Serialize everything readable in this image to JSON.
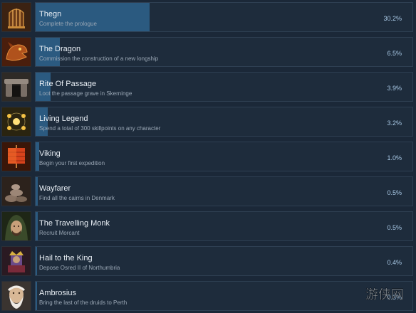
{
  "achievements": [
    {
      "title": "Thegn",
      "description": "Complete the prologue",
      "percent": "30.2%",
      "progress": 0.302,
      "icon": "cage-icon"
    },
    {
      "title": "The Dragon",
      "description": "Commission the construction of a new longship",
      "percent": "6.5%",
      "progress": 0.065,
      "icon": "dragon-head-icon"
    },
    {
      "title": "Rite Of Passage",
      "description": "Loot the passage grave in Skerninge",
      "percent": "3.9%",
      "progress": 0.039,
      "icon": "standing-stones-icon"
    },
    {
      "title": "Living Legend",
      "description": "Spend a total of 300 skillpoints on any character",
      "percent": "3.2%",
      "progress": 0.032,
      "icon": "glowing-orbs-icon"
    },
    {
      "title": "Viking",
      "description": "Begin your first expedition",
      "percent": "1.0%",
      "progress": 0.01,
      "icon": "sail-icon"
    },
    {
      "title": "Wayfarer",
      "description": "Find all the cairns in Denmark",
      "percent": "0.5%",
      "progress": 0.005,
      "icon": "cairn-icon"
    },
    {
      "title": "The Travelling Monk",
      "description": "Recruit Morcant",
      "percent": "0.5%",
      "progress": 0.005,
      "icon": "hooded-monk-icon"
    },
    {
      "title": "Hail to the King",
      "description": "Depose Osred II of Northumbria",
      "percent": "0.4%",
      "progress": 0.004,
      "icon": "king-icon"
    },
    {
      "title": "Ambrosius",
      "description": "Bring the last of the druids to Perth",
      "percent": "0.3%",
      "progress": 0.003,
      "icon": "old-druid-icon"
    }
  ],
  "watermark": {
    "text": "游侠网"
  },
  "colors": {
    "background": "#1b2838",
    "panel": "#1e2c3c",
    "progress_fill": "#2b5a80",
    "percent_text": "#a9c9e6"
  }
}
